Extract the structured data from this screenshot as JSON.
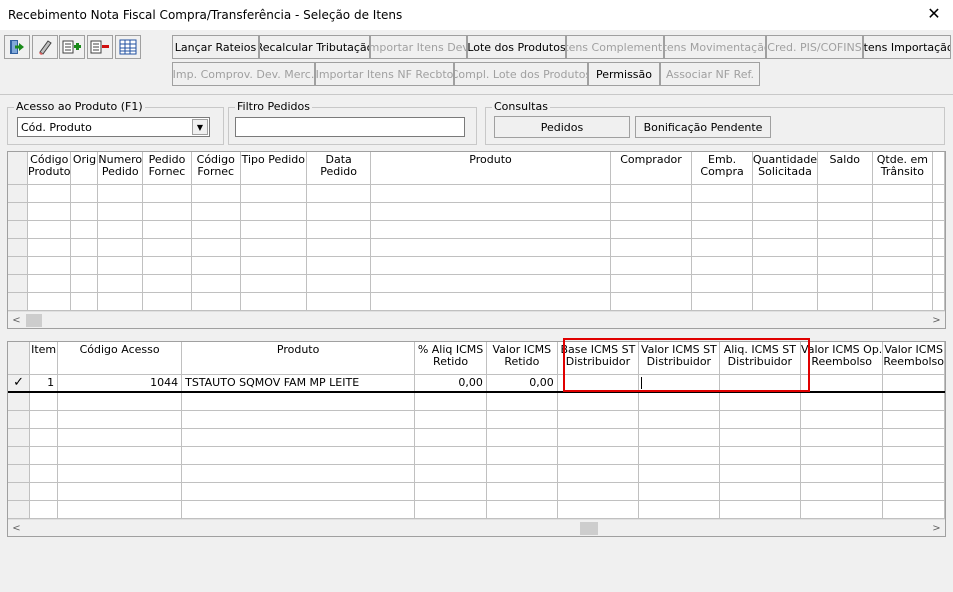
{
  "window": {
    "title": "Recebimento Nota Fiscal Compra/Transferência - Seleção de Itens"
  },
  "icons": {
    "exit": "exit-door-icon",
    "edit": "eraser-icon",
    "add": "add-item-icon",
    "remove": "remove-item-icon",
    "grid": "grid-icon"
  },
  "toolbar": {
    "row1": [
      {
        "label": "Lançar Rateios",
        "enabled": true
      },
      {
        "label": "Recalcular Tributação",
        "enabled": true
      },
      {
        "label": "Importar Itens Dev.",
        "enabled": false
      },
      {
        "label": "Lote dos Produtos",
        "enabled": true
      },
      {
        "label": "Itens Complemento",
        "enabled": false
      },
      {
        "label": "Itens Movimentação",
        "enabled": false
      },
      {
        "label": "Cred. PIS/COFINS",
        "enabled": false
      },
      {
        "label": "Itens Importação",
        "enabled": true
      }
    ],
    "row2": [
      {
        "label": "Imp. Comprov. Dev. Merc.",
        "enabled": false
      },
      {
        "label": "Importar Itens NF Recbto",
        "enabled": false
      },
      {
        "label": "Compl. Lote dos Produtos",
        "enabled": false
      },
      {
        "label": "Permissão",
        "enabled": true
      },
      {
        "label": "Associar NF Ref.",
        "enabled": false
      }
    ]
  },
  "acesso": {
    "legend": "Acesso ao Produto (F1)",
    "value": "Cód. Produto"
  },
  "filtro": {
    "legend": "Filtro Pedidos",
    "value": ""
  },
  "consultas": {
    "legend": "Consultas",
    "pedidos": "Pedidos",
    "bonificacao": "Bonificação Pendente"
  },
  "top_grid": {
    "columns": [
      "Código Produto",
      "Orig",
      "Numero Pedido",
      "Pedido Fornec",
      "Código Fornec",
      "Tipo Pedido",
      "Data Pedido",
      "Produto",
      "Comprador",
      "Emb. Compra",
      "Quantidade Solicitada",
      "Saldo",
      "Qtde. em Trânsito"
    ]
  },
  "bottom_grid": {
    "columns": [
      "Item",
      "Código Acesso",
      "Produto",
      "% Aliq ICMS Retido",
      "Valor ICMS Retido",
      "Base ICMS ST Distribuidor",
      "Valor ICMS ST Distribuidor",
      "Aliq. ICMS ST Distribuidor",
      "Valor ICMS Op. Reembolso",
      "Valor ICMS Reembolso"
    ],
    "rows": [
      {
        "selected_mark": "✓",
        "item": "1",
        "codigo_acesso": "1044",
        "produto": "TSTAUTO SQMOV FAM MP LEITE",
        "aliq_icms_retido": "0,00",
        "valor_icms_retido": "0,00",
        "base_icms_st": "",
        "valor_icms_st": "",
        "aliq_icms_st": "",
        "valor_icms_op_reembolso": "",
        "valor_icms_reembolso": ""
      }
    ]
  },
  "scroll": {
    "left": "<",
    "right": ">"
  },
  "colors": {
    "highlight": "#e00000"
  }
}
